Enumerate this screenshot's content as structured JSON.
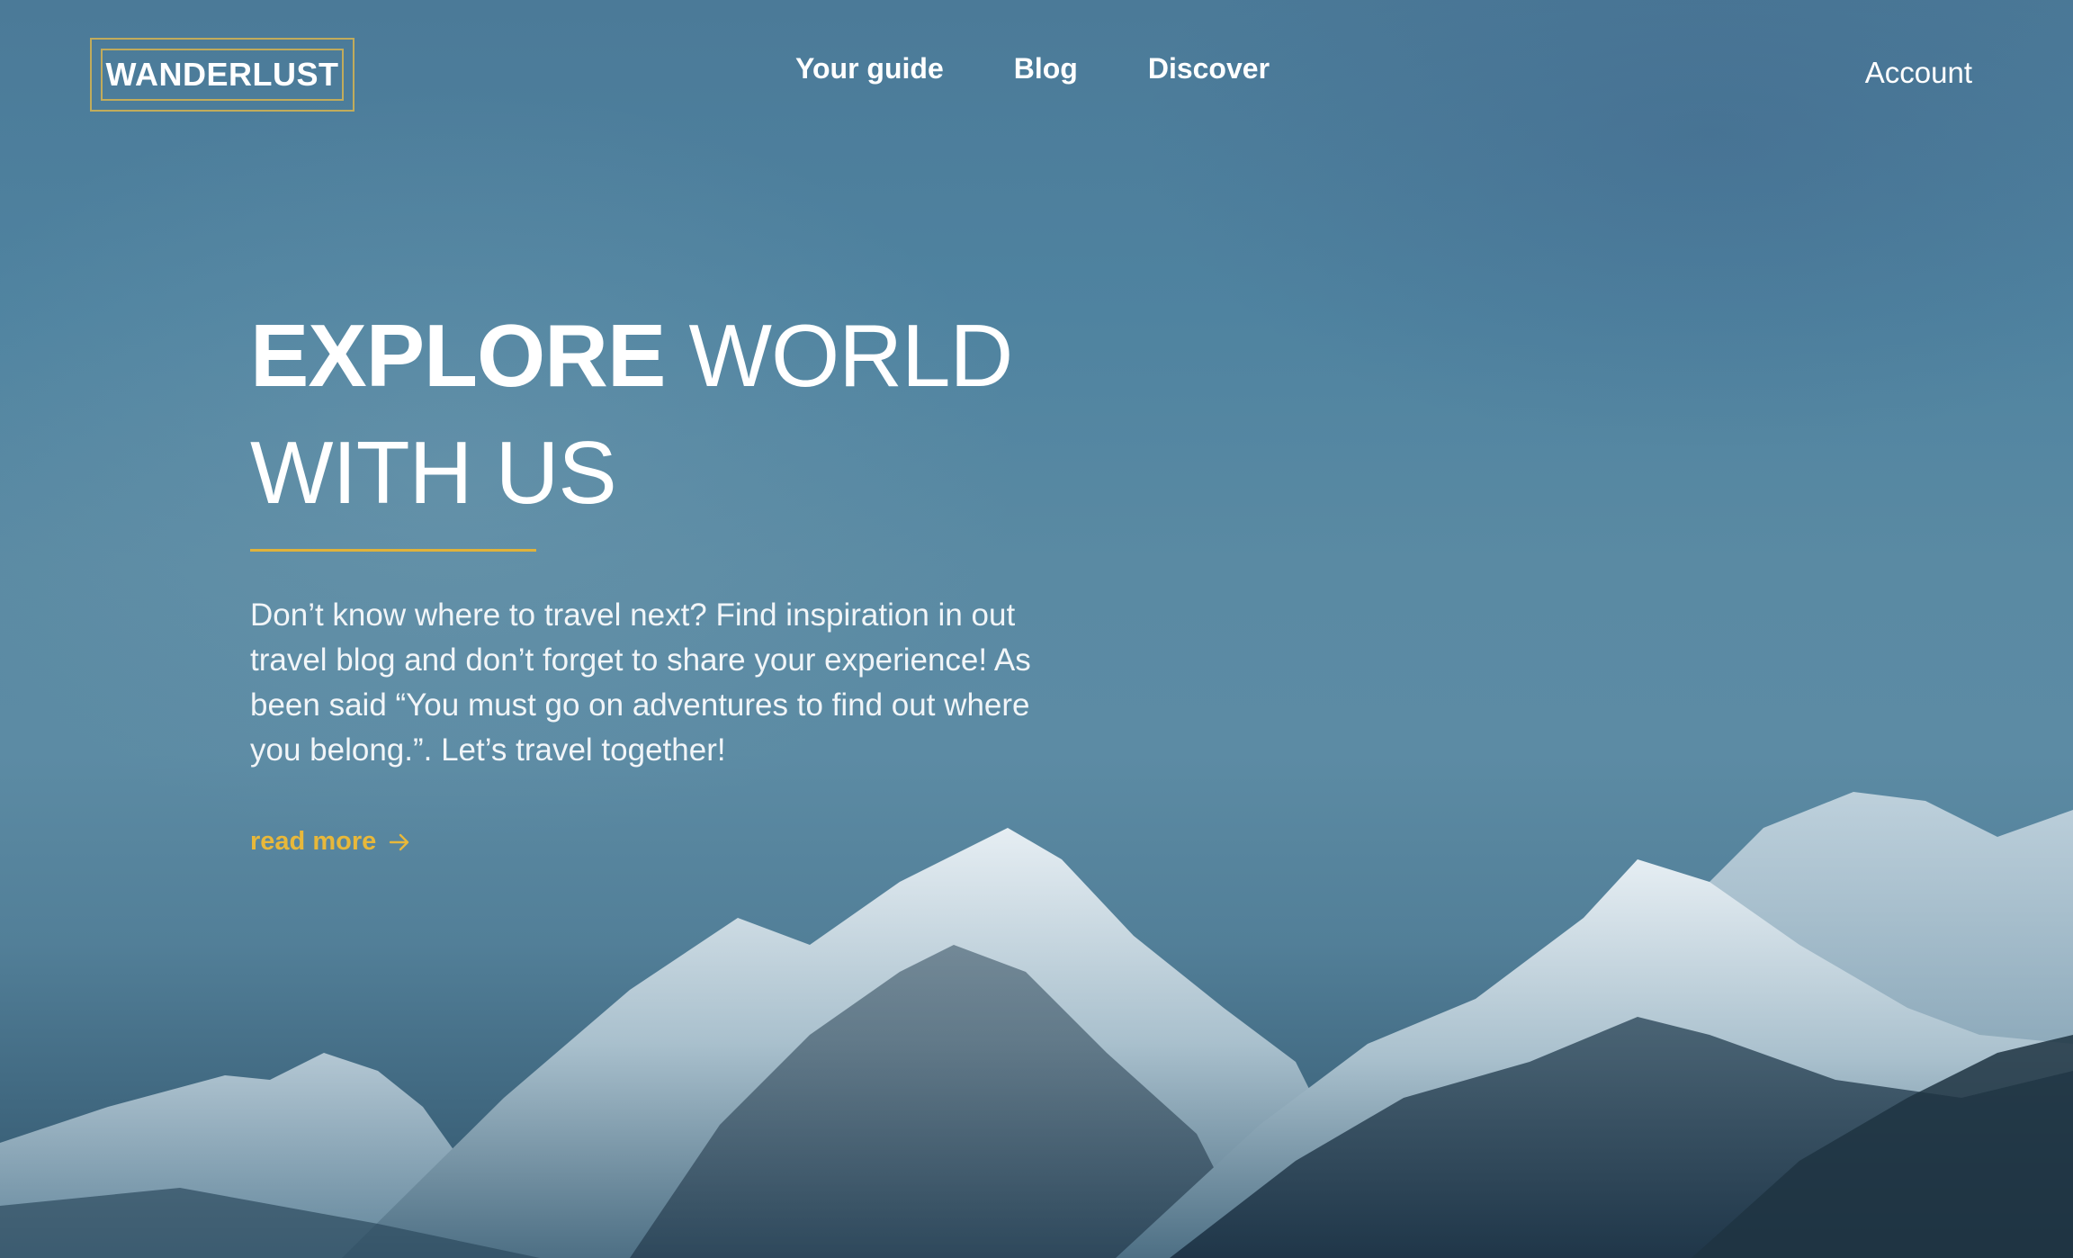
{
  "brand": {
    "name": "WANDERLUST",
    "accent_color": "#e0b23a"
  },
  "nav": {
    "items": [
      {
        "label": "Your guide"
      },
      {
        "label": "Blog"
      },
      {
        "label": "Discover"
      }
    ],
    "account_label": "Account"
  },
  "hero": {
    "headline_strong": "EXPLORE",
    "headline_light_1": " WORLD",
    "headline_light_2": "WITH US",
    "description": "Don’t know where to travel next? Find inspiration in out travel blog and don’t forget to share your experience! As been said “You must go on adventures to find out where you belong.”. Let’s travel together!",
    "cta_label": "read more",
    "cta_icon": "arrow-right-icon"
  },
  "background": {
    "subject": "snowy-mountain-range",
    "tint_color": "#4f83a0"
  }
}
